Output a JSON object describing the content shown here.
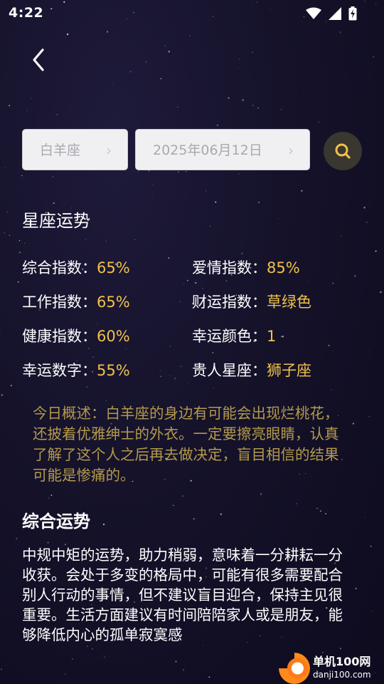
{
  "status_bar": {
    "time": "4:22"
  },
  "search": {
    "sign_value": "白羊座",
    "sign_arrow": "›",
    "date_value": "2025年06月12日",
    "date_arrow": "›"
  },
  "fortune": {
    "section_title": "星座运势",
    "stats": [
      {
        "label": "综合指数：",
        "value": "65%"
      },
      {
        "label": "爱情指数：",
        "value": "85%"
      },
      {
        "label": "工作指数：",
        "value": "65%"
      },
      {
        "label": "财运指数：",
        "value": "草绿色"
      },
      {
        "label": "健康指数：",
        "value": "60%"
      },
      {
        "label": "幸运颜色：",
        "value": "1"
      },
      {
        "label": "幸运数字：",
        "value": "55%"
      },
      {
        "label": "贵人星座：",
        "value": "狮子座"
      }
    ],
    "summary": "今日概述：白羊座的身边有可能会出现烂桃花，还披着优雅绅士的外衣。一定要擦亮眼睛，认真了解了这个人之后再去做决定，盲目相信的结果可能是惨痛的。",
    "overall_title": "综合运势",
    "overall_text": "中规中矩的运势，助力稍弱，意味着一分耕耘一分收获。会处于多变的格局中，可能有很多需要配合别人行动的事情，但不建议盲目迎合，保持主见很重要。生活方面建议有时间陪陪家人或是朋友，能够降低内心的孤单寂寞感"
  },
  "watermark": {
    "name": "单机100网",
    "url": "danji100.com"
  },
  "colors": {
    "accent_value": "#f0c24a",
    "summary_text": "#b49a4c",
    "background": "#15122a",
    "search_button": "#3a3731"
  },
  "icons": [
    "wifi-icon",
    "signal-icon",
    "battery-charging-icon",
    "back-arrow-icon",
    "search-icon"
  ]
}
